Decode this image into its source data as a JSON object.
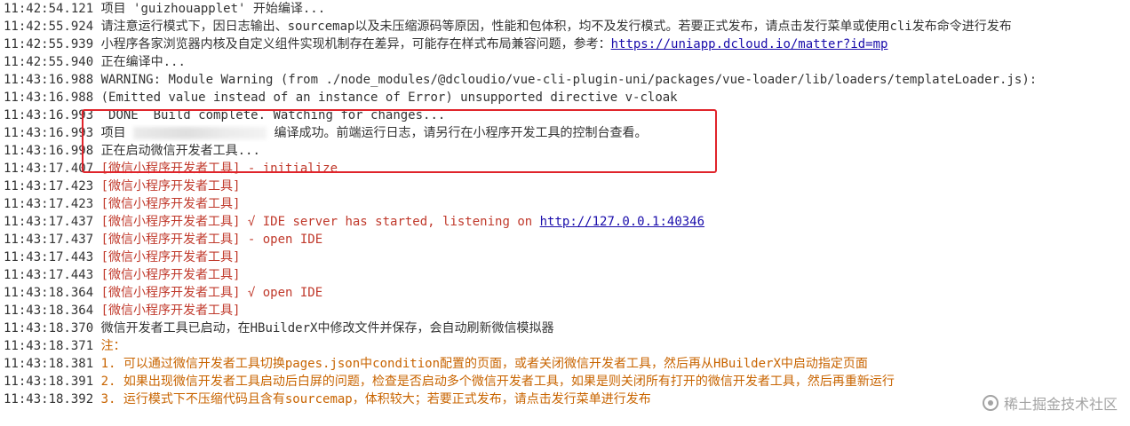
{
  "colors": {
    "normal_text": "#333333",
    "red_text": "#c0392b",
    "orange_text": "#c86400",
    "link": "#1a0dab",
    "highlight_border": "#e0242b"
  },
  "log": [
    {
      "time": "11:42:54.121",
      "text": "项目 'guizhouapplet' 开始编译...",
      "style": "normal"
    },
    {
      "time": "11:42:55.924",
      "text": "请注意运行模式下，因日志输出、sourcemap以及未压缩源码等原因，性能和包体积，均不及发行模式。若要正式发布，请点击发行菜单或使用cli发布命令进行发布",
      "style": "normal"
    },
    {
      "time": "11:42:55.939",
      "text": "小程序各家浏览器内核及自定义组件实现机制存在差异，可能存在样式布局兼容问题，参考：",
      "link": "https://uniapp.dcloud.io/matter?id=mp",
      "style": "normal"
    },
    {
      "time": "11:42:55.940",
      "text": "正在编译中...",
      "style": "normal"
    },
    {
      "time": "11:43:16.988",
      "text": "WARNING: Module Warning (from ./node_modules/@dcloudio/vue-cli-plugin-uni/packages/vue-loader/lib/loaders/templateLoader.js):",
      "style": "normal"
    },
    {
      "time": "11:43:16.988",
      "text": "(Emitted value instead of an instance of Error) unsupported directive v-cloak",
      "style": "normal"
    },
    {
      "time": "11:43:16.993",
      "text": " DONE  Build complete. Watching for changes...",
      "style": "normal"
    },
    {
      "time": "11:43:16.993",
      "prefix": "项目 ",
      "text": " 编译成功。前端运行日志，请另行在小程序开发工具的控制台查看。",
      "style": "normal",
      "redacted": true
    },
    {
      "time": "11:43:16.998",
      "text": "正在启动微信开发者工具...",
      "style": "normal"
    },
    {
      "time": "11:43:17.407",
      "text": "[微信小程序开发者工具] - initialize",
      "style": "red"
    },
    {
      "time": "11:43:17.423",
      "text": "[微信小程序开发者工具]",
      "style": "red"
    },
    {
      "time": "11:43:17.423",
      "text": "[微信小程序开发者工具]",
      "style": "red"
    },
    {
      "time": "11:43:17.437",
      "text": "[微信小程序开发者工具] √ IDE server has started, listening on ",
      "link": "http://127.0.0.1:40346",
      "style": "red"
    },
    {
      "time": "11:43:17.437",
      "text": "[微信小程序开发者工具] - open IDE",
      "style": "red"
    },
    {
      "time": "11:43:17.443",
      "text": "[微信小程序开发者工具]",
      "style": "red"
    },
    {
      "time": "11:43:17.443",
      "text": "[微信小程序开发者工具]",
      "style": "red"
    },
    {
      "time": "11:43:18.364",
      "text": "[微信小程序开发者工具] √ open IDE",
      "style": "red"
    },
    {
      "time": "11:43:18.364",
      "text": "[微信小程序开发者工具]",
      "style": "red"
    },
    {
      "time": "11:43:18.370",
      "text": "微信开发者工具已启动，在HBuilderX中修改文件并保存，会自动刷新微信模拟器",
      "style": "normal"
    },
    {
      "time": "11:43:18.371",
      "text": "注：",
      "style": "orange"
    },
    {
      "time": "11:43:18.381",
      "text": "1. 可以通过微信开发者工具切换pages.json中condition配置的页面，或者关闭微信开发者工具，然后再从HBuilderX中启动指定页面",
      "style": "orange"
    },
    {
      "time": "11:43:18.391",
      "text": "2. 如果出现微信开发者工具启动后白屏的问题，检查是否启动多个微信开发者工具，如果是则关闭所有打开的微信开发者工具，然后再重新运行",
      "style": "orange"
    },
    {
      "time": "11:43:18.392",
      "text": "3. 运行模式下不压缩代码且含有sourcemap，体积较大；若要正式发布，请点击发行菜单进行发布",
      "style": "orange"
    }
  ],
  "watermark": {
    "text": "稀土掘金技术社区"
  }
}
